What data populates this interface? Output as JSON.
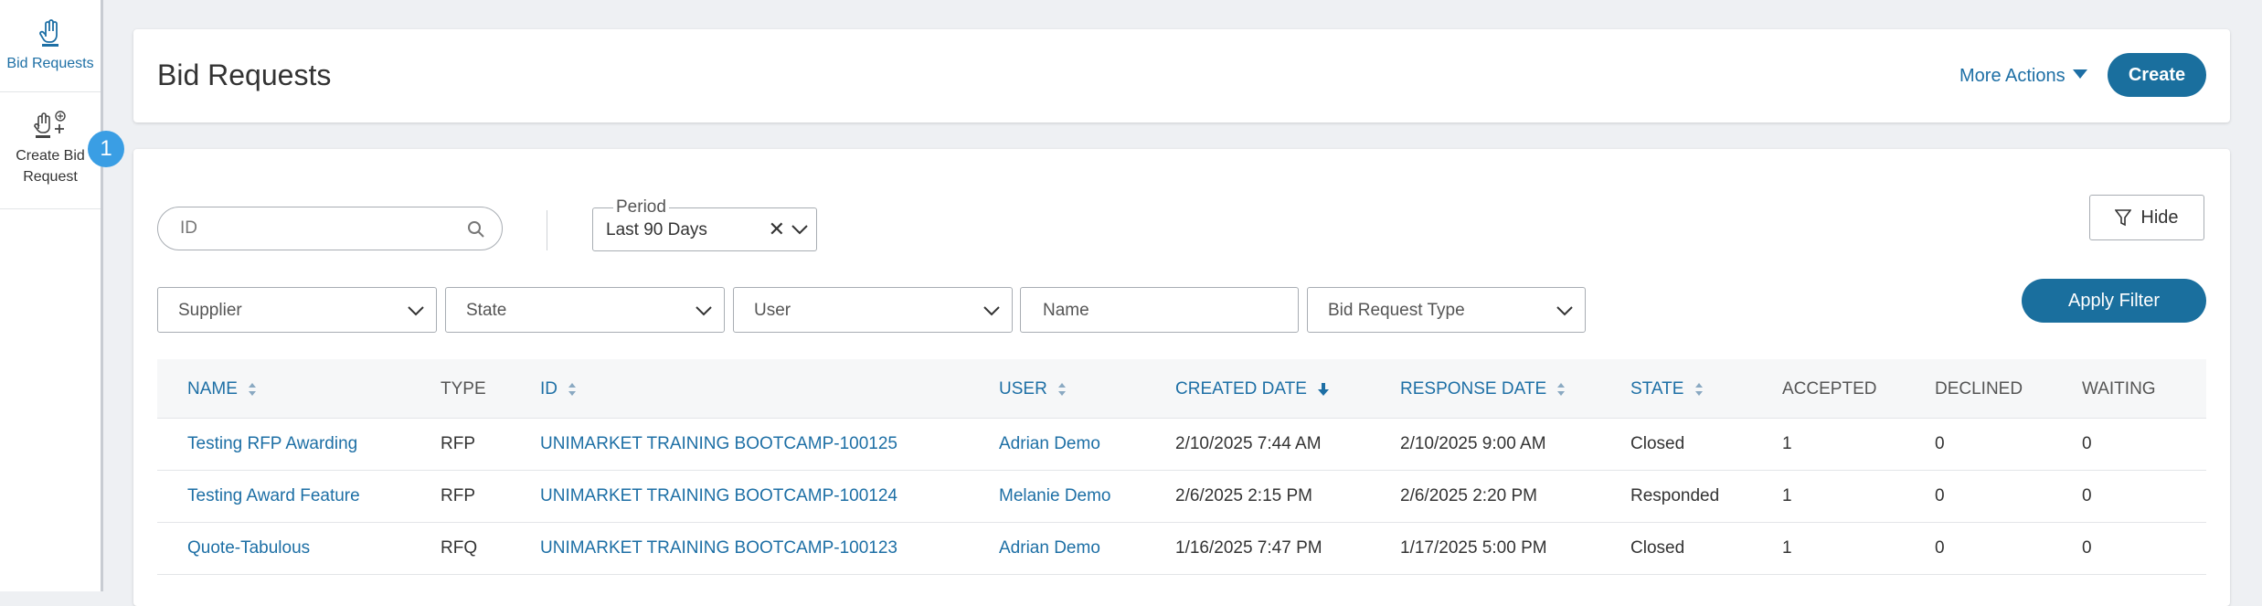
{
  "sidebar": {
    "items": [
      {
        "label": "Bid Requests",
        "icon": "hand-icon"
      },
      {
        "label": "Create Bid Request",
        "icon": "create-bid-icon"
      }
    ],
    "badge": "1"
  },
  "header": {
    "title": "Bid Requests",
    "more_actions": "More Actions",
    "create": "Create"
  },
  "filters": {
    "id_placeholder": "ID",
    "period_label": "Period",
    "period_value": "Last 90 Days",
    "period_clear": "✕",
    "hide": "Hide",
    "apply": "Apply Filter",
    "supplier": "Supplier",
    "state": "State",
    "user": "User",
    "name_placeholder": "Name",
    "bid_request_type": "Bid Request Type"
  },
  "table": {
    "headers": {
      "name": "NAME",
      "type": "TYPE",
      "id": "ID",
      "user": "USER",
      "created_date": "CREATED DATE",
      "response_date": "RESPONSE DATE",
      "state": "STATE",
      "accepted": "ACCEPTED",
      "declined": "DECLINED",
      "waiting": "WAITING"
    },
    "rows": [
      {
        "name": "Testing RFP Awarding",
        "type": "RFP",
        "id": "UNIMARKET TRAINING BOOTCAMP-100125",
        "user": "Adrian Demo",
        "created_date": "2/10/2025 7:44 AM",
        "response_date": "2/10/2025 9:00 AM",
        "state": "Closed",
        "accepted": "1",
        "declined": "0",
        "waiting": "0"
      },
      {
        "name": "Testing Award Feature",
        "type": "RFP",
        "id": "UNIMARKET TRAINING BOOTCAMP-100124",
        "user": "Melanie Demo",
        "created_date": "2/6/2025 2:15 PM",
        "response_date": "2/6/2025 2:20 PM",
        "state": "Responded",
        "accepted": "1",
        "declined": "0",
        "waiting": "0"
      },
      {
        "name": "Quote-Tabulous",
        "type": "RFQ",
        "id": "UNIMARKET TRAINING BOOTCAMP-100123",
        "user": "Adrian Demo",
        "created_date": "1/16/2025 7:47 PM",
        "response_date": "1/17/2025 5:00 PM",
        "state": "Closed",
        "accepted": "1",
        "declined": "0",
        "waiting": "0"
      }
    ]
  },
  "colors": {
    "accent": "#1d6fa5",
    "primary_button": "#1a6f9e",
    "badge": "#3a9ee4",
    "background": "#eef0f3"
  }
}
